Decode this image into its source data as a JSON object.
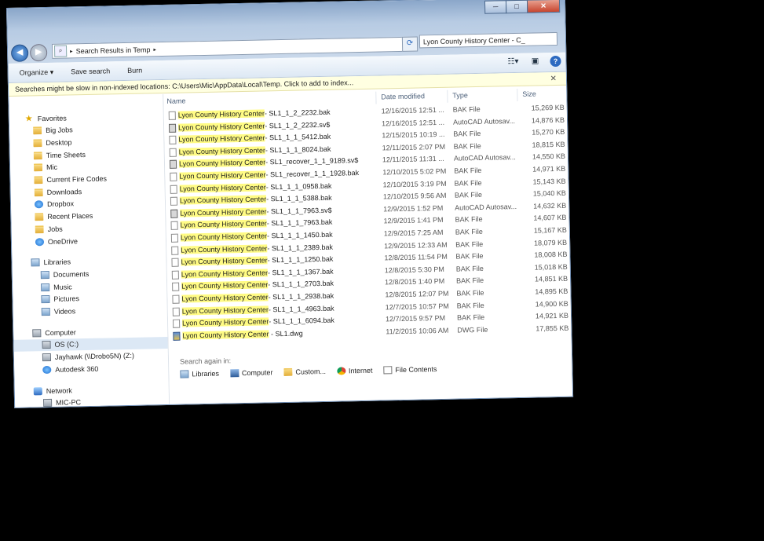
{
  "window": {
    "caption_buttons": {
      "minimize": "─",
      "maximize": "□",
      "close": "✕"
    }
  },
  "nav": {
    "back_icon": "back-arrow-icon",
    "forward_icon": "forward-arrow-icon"
  },
  "address": {
    "path": "Search Results in Temp",
    "refresh_icon": "refresh-icon"
  },
  "search": {
    "value": "Lyon County History Center - C_"
  },
  "toolbar": {
    "organize": "Organize ▾",
    "save_search": "Save search",
    "burn": "Burn"
  },
  "infobar": {
    "text": "Searches might be slow in non-indexed locations: C:\\Users\\Mic\\AppData\\Local\\Temp. Click to add to index...",
    "close": "✕"
  },
  "sidebar": {
    "favorites": "Favorites",
    "favorite_items": [
      "Big Jobs",
      "Desktop",
      "Time Sheets",
      "Mic",
      "Current Fire Codes",
      "Downloads",
      "Dropbox",
      "Recent Places",
      "Jobs",
      "OneDrive"
    ],
    "libraries": "Libraries",
    "library_items": [
      "Documents",
      "Music",
      "Pictures",
      "Videos"
    ],
    "computer": "Computer",
    "computer_items": [
      "OS (C:)",
      "Jayhawk (\\\\Drobo5N) (Z:)",
      "Autodesk 360"
    ],
    "network": "Network",
    "network_items": [
      "MIC-PC"
    ]
  },
  "columns": {
    "name": "Name",
    "date": "Date modified",
    "type": "Type",
    "size": "Size"
  },
  "files": [
    {
      "prefix": "Lyon County History Center",
      "rest": "- SL1_1_2_2232.bak",
      "date": "12/16/2015 12:51 ...",
      "type": "BAK File",
      "size": "15,269 KB",
      "icon": "file"
    },
    {
      "prefix": "Lyon County History Center",
      "rest": "- SL1_1_2_2232.sv$",
      "date": "12/16/2015 12:51 ...",
      "type": "AutoCAD Autosav...",
      "size": "14,876 KB",
      "icon": "sv"
    },
    {
      "prefix": "Lyon County History Center",
      "rest": "- SL1_1_1_5412.bak",
      "date": "12/15/2015 10:19 ...",
      "type": "BAK File",
      "size": "15,270 KB",
      "icon": "file"
    },
    {
      "prefix": "Lyon County History Center",
      "rest": "- SL1_1_1_8024.bak",
      "date": "12/11/2015 2:07 PM",
      "type": "BAK File",
      "size": "18,815 KB",
      "icon": "file"
    },
    {
      "prefix": "Lyon County History Center",
      "rest": "- SL1_recover_1_1_9189.sv$",
      "date": "12/11/2015 11:31 ...",
      "type": "AutoCAD Autosav...",
      "size": "14,550 KB",
      "icon": "sv"
    },
    {
      "prefix": "Lyon County History Center",
      "rest": "- SL1_recover_1_1_1928.bak",
      "date": "12/10/2015 5:02 PM",
      "type": "BAK File",
      "size": "14,971 KB",
      "icon": "file"
    },
    {
      "prefix": "Lyon County History Center",
      "rest": "- SL1_1_1_0958.bak",
      "date": "12/10/2015 3:19 PM",
      "type": "BAK File",
      "size": "15,143 KB",
      "icon": "file"
    },
    {
      "prefix": "Lyon County History Center",
      "rest": "- SL1_1_1_5388.bak",
      "date": "12/10/2015 9:56 AM",
      "type": "BAK File",
      "size": "15,040 KB",
      "icon": "file"
    },
    {
      "prefix": "Lyon County History Center",
      "rest": "- SL1_1_1_7963.sv$",
      "date": "12/9/2015 1:52 PM",
      "type": "AutoCAD Autosav...",
      "size": "14,632 KB",
      "icon": "sv"
    },
    {
      "prefix": "Lyon County History Center",
      "rest": "- SL1_1_1_7963.bak",
      "date": "12/9/2015 1:41 PM",
      "type": "BAK File",
      "size": "14,607 KB",
      "icon": "file"
    },
    {
      "prefix": "Lyon County History Center",
      "rest": "- SL1_1_1_1450.bak",
      "date": "12/9/2015 7:25 AM",
      "type": "BAK File",
      "size": "15,167 KB",
      "icon": "file"
    },
    {
      "prefix": "Lyon County History Center",
      "rest": "- SL1_1_1_2389.bak",
      "date": "12/9/2015 12:33 AM",
      "type": "BAK File",
      "size": "18,079 KB",
      "icon": "file"
    },
    {
      "prefix": "Lyon County History Center",
      "rest": "- SL1_1_1_1250.bak",
      "date": "12/8/2015 11:54 PM",
      "type": "BAK File",
      "size": "18,008 KB",
      "icon": "file"
    },
    {
      "prefix": "Lyon County History Center",
      "rest": "- SL1_1_1_1367.bak",
      "date": "12/8/2015 5:30 PM",
      "type": "BAK File",
      "size": "15,018 KB",
      "icon": "file"
    },
    {
      "prefix": "Lyon County History Center",
      "rest": "- SL1_1_1_2703.bak",
      "date": "12/8/2015 1:40 PM",
      "type": "BAK File",
      "size": "14,851 KB",
      "icon": "file"
    },
    {
      "prefix": "Lyon County History Center",
      "rest": "- SL1_1_1_2938.bak",
      "date": "12/8/2015 12:07 PM",
      "type": "BAK File",
      "size": "14,895 KB",
      "icon": "file"
    },
    {
      "prefix": "Lyon County History Center",
      "rest": "- SL1_1_1_4963.bak",
      "date": "12/7/2015 10:57 PM",
      "type": "BAK File",
      "size": "14,900 KB",
      "icon": "file"
    },
    {
      "prefix": "Lyon County History Center",
      "rest": "- SL1_1_1_6094.bak",
      "date": "12/7/2015 9:57 PM",
      "type": "BAK File",
      "size": "14,921 KB",
      "icon": "file"
    },
    {
      "prefix": "Lyon County History Center",
      "rest": " - SL1.dwg",
      "date": "11/2/2015 10:06 AM",
      "type": "DWG File",
      "size": "17,855 KB",
      "icon": "dwg"
    }
  ],
  "search_again": {
    "label": "Search again in:",
    "targets": [
      {
        "label": "Libraries",
        "icon": "libraries-icon"
      },
      {
        "label": "Computer",
        "icon": "computer-icon"
      },
      {
        "label": "Custom...",
        "icon": "folder-icon"
      },
      {
        "label": "Internet",
        "icon": "chrome-icon"
      },
      {
        "label": "File Contents",
        "icon": "document-icon"
      }
    ]
  }
}
